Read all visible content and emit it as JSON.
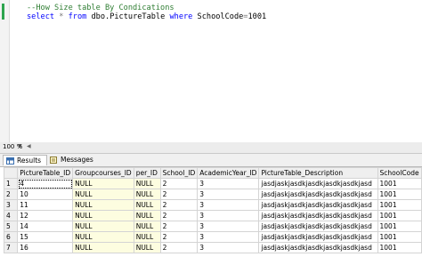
{
  "editor": {
    "comment": "--How Size table By Condications",
    "query_tokens": {
      "select": "select",
      "star": "*",
      "from": "from",
      "table": "dbo.PictureTable",
      "where": "where",
      "column": "SchoolCode",
      "eq": "=",
      "value": "1001"
    }
  },
  "zoom": {
    "value": "100 %"
  },
  "tabs": {
    "results": "Results",
    "messages": "Messages"
  },
  "grid": {
    "columns": [
      "PictureTable_ID",
      "Groupcourses_ID",
      "per_ID",
      "School_ID",
      "AcademicYear_ID",
      "PictureTable_Description",
      "SchoolCode"
    ],
    "rows": [
      {
        "n": "1",
        "cells": [
          "4",
          "NULL",
          "NULL",
          "2",
          "3",
          "jasdjaskjasdkjasdkjasdkjasdkjasd",
          "1001"
        ]
      },
      {
        "n": "2",
        "cells": [
          "10",
          "NULL",
          "NULL",
          "2",
          "3",
          "jasdjaskjasdkjasdkjasdkjasdkjasd",
          "1001"
        ]
      },
      {
        "n": "3",
        "cells": [
          "11",
          "NULL",
          "NULL",
          "2",
          "3",
          "jasdjaskjasdkjasdkjasdkjasdkjasd",
          "1001"
        ]
      },
      {
        "n": "4",
        "cells": [
          "12",
          "NULL",
          "NULL",
          "2",
          "3",
          "jasdjaskjasdkjasdkjasdkjasdkjasd",
          "1001"
        ]
      },
      {
        "n": "5",
        "cells": [
          "14",
          "NULL",
          "NULL",
          "2",
          "3",
          "jasdjaskjasdkjasdkjasdkjasdkjasd",
          "1001"
        ]
      },
      {
        "n": "6",
        "cells": [
          "15",
          "NULL",
          "NULL",
          "2",
          "3",
          "jasdjaskjasdkjasdkjasdkjasdkjasd",
          "1001"
        ]
      },
      {
        "n": "7",
        "cells": [
          "16",
          "NULL",
          "NULL",
          "2",
          "3",
          "jasdjaskjasdkjasdkjasdkjasdkjasd",
          "1001"
        ]
      }
    ]
  },
  "colors": {
    "comment": "#2e7d32",
    "keyword": "#0000ff",
    "null_cell_bg": "#fdfde0"
  }
}
